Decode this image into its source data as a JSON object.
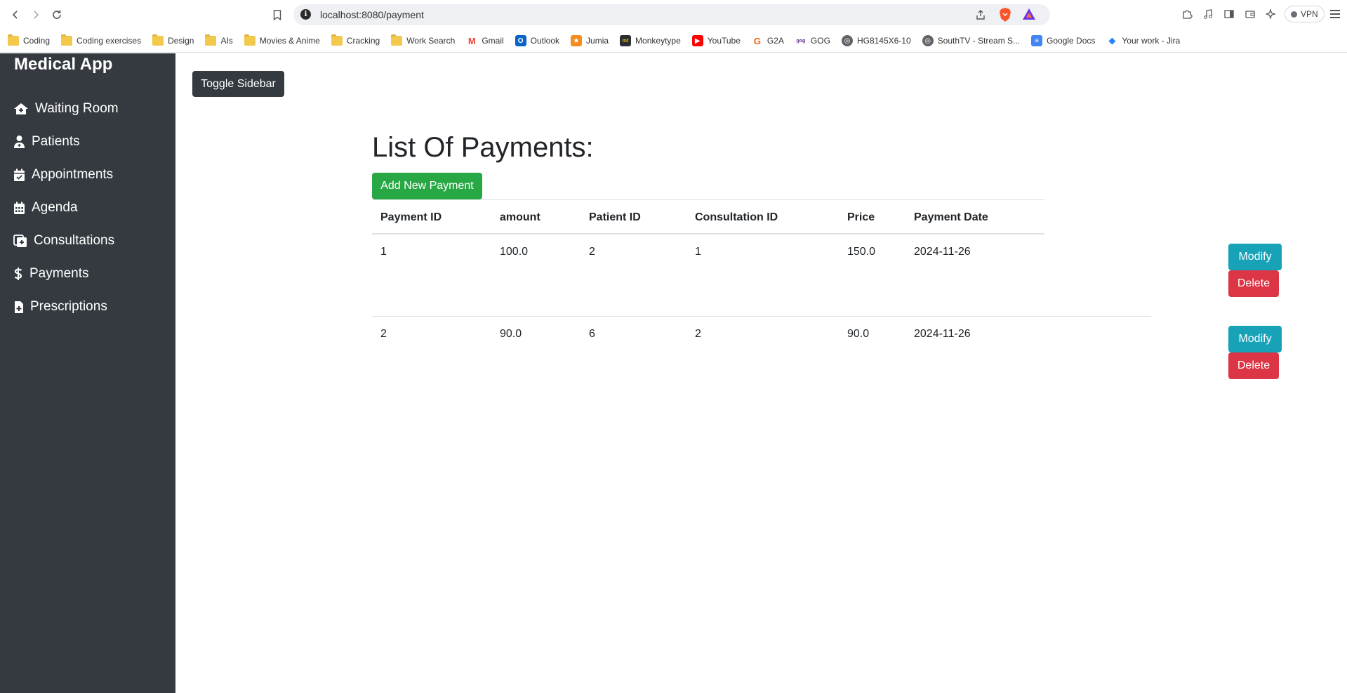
{
  "browser": {
    "url": "localhost:8080/payment",
    "vpn_label": "VPN",
    "bookmarks": [
      {
        "label": "Coding",
        "icon": "folder-icon"
      },
      {
        "label": "Coding exercises",
        "icon": "folder-icon"
      },
      {
        "label": "Design",
        "icon": "folder-icon"
      },
      {
        "label": "AIs",
        "icon": "folder-icon"
      },
      {
        "label": "Movies & Anime",
        "icon": "folder-icon"
      },
      {
        "label": "Cracking",
        "icon": "folder-icon"
      },
      {
        "label": "Work Search",
        "icon": "folder-icon"
      },
      {
        "label": "Gmail",
        "icon": "gmail-icon"
      },
      {
        "label": "Outlook",
        "icon": "outlook-icon"
      },
      {
        "label": "Jumia",
        "icon": "jumia-icon"
      },
      {
        "label": "Monkeytype",
        "icon": "monkeytype-icon"
      },
      {
        "label": "YouTube",
        "icon": "youtube-icon"
      },
      {
        "label": "G2A",
        "icon": "g2a-icon"
      },
      {
        "label": "GOG",
        "icon": "gog-icon"
      },
      {
        "label": "HG8145X6-10",
        "icon": "globe-icon"
      },
      {
        "label": "SouthTV - Stream S...",
        "icon": "globe-icon"
      },
      {
        "label": "Google Docs",
        "icon": "google-docs-icon"
      },
      {
        "label": "Your work - Jira",
        "icon": "jira-icon"
      }
    ]
  },
  "sidebar": {
    "brand": "Medical App",
    "items": [
      {
        "label": "Waiting Room",
        "icon": "home-icon"
      },
      {
        "label": "Patients",
        "icon": "user-doctor-icon"
      },
      {
        "label": "Appointments",
        "icon": "calendar-check-icon"
      },
      {
        "label": "Agenda",
        "icon": "calendar-icon"
      },
      {
        "label": "Consultations",
        "icon": "clipboard-plus-icon"
      },
      {
        "label": "Payments",
        "icon": "dollar-icon"
      },
      {
        "label": "Prescriptions",
        "icon": "file-medical-icon"
      }
    ]
  },
  "main": {
    "toggle_label": "Toggle Sidebar",
    "title": "List Of Payments:",
    "add_label": "Add New Payment",
    "table": {
      "headers": [
        "Payment ID",
        "amount",
        "Patient ID",
        "Consultation ID",
        "Price",
        "Payment Date"
      ],
      "rows": [
        [
          "1",
          "100.0",
          "2",
          "1",
          "150.0",
          "2024-11-26"
        ],
        [
          "2",
          "90.0",
          "6",
          "2",
          "90.0",
          "2024-11-26"
        ]
      ],
      "modify_label": "Modify",
      "delete_label": "Delete"
    }
  },
  "colors": {
    "sidebar_bg": "#343a40",
    "add_button": "#28a745",
    "modify_button": "#17a2b8",
    "delete_button": "#dc3545"
  }
}
